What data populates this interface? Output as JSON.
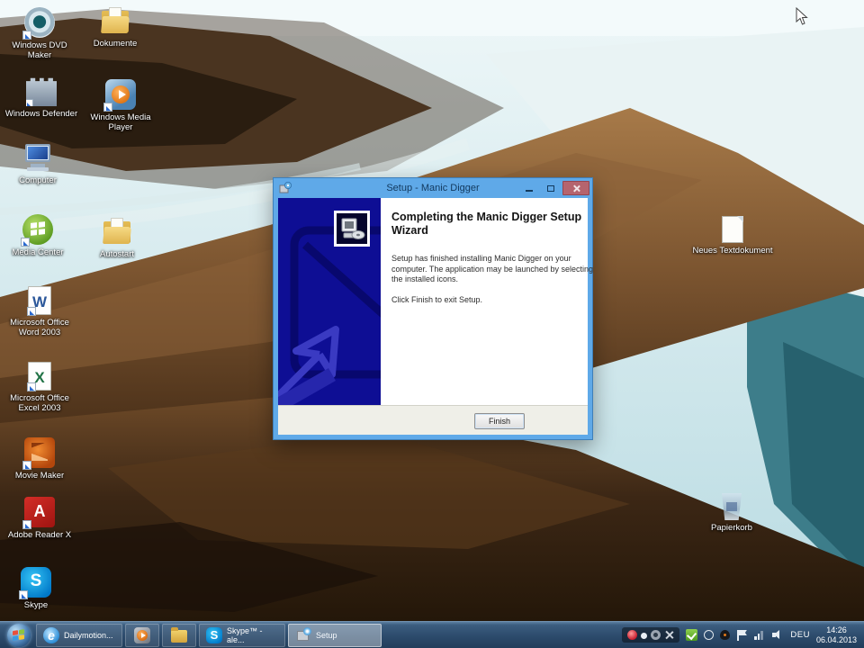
{
  "desktop": {
    "icons": [
      {
        "name": "windows-dvd-maker",
        "label": "Windows DVD Maker"
      },
      {
        "name": "documents-folder",
        "label": "Dokumente"
      },
      {
        "name": "windows-defender",
        "label": "Windows Defender"
      },
      {
        "name": "windows-media-player",
        "label": "Windows Media Player"
      },
      {
        "name": "computer",
        "label": "Computer"
      },
      {
        "name": "media-center",
        "label": "Media Center"
      },
      {
        "name": "autostart-folder",
        "label": "Autostart"
      },
      {
        "name": "word-2003",
        "label": "Microsoft Office Word 2003"
      },
      {
        "name": "excel-2003",
        "label": "Microsoft Office Excel 2003"
      },
      {
        "name": "movie-maker",
        "label": "Movie Maker"
      },
      {
        "name": "adobe-reader",
        "label": "Adobe Reader X"
      },
      {
        "name": "skype",
        "label": "Skype"
      },
      {
        "name": "text-document",
        "label": "Neues Textdokument"
      },
      {
        "name": "recycle-bin",
        "label": "Papierkorb"
      }
    ]
  },
  "dialog": {
    "title": "Setup - Manic Digger",
    "heading": "Completing the Manic Digger Setup Wizard",
    "paragraph1": "Setup has finished installing Manic Digger on your computer. The application may be launched by selecting the installed icons.",
    "paragraph2": "Click Finish to exit Setup.",
    "finish_button": "Finish"
  },
  "glyphs": {
    "word": "W",
    "excel": "X",
    "skype": "S",
    "adobe": "A",
    "ie": "e"
  },
  "taskbar": {
    "ie_button_label": "Dailymotion...",
    "skype_button_label": "Skype™ - ale...",
    "setup_button_label": "Setup",
    "tray": {
      "language": "DEU",
      "time": "14:26",
      "date": "06.04.2013"
    }
  },
  "colors": {
    "title_bar": "#5fa9e8",
    "wizard_panel": "#0e0e94",
    "close_button": "#b5646e",
    "taskbar": "#2c4b6c"
  }
}
